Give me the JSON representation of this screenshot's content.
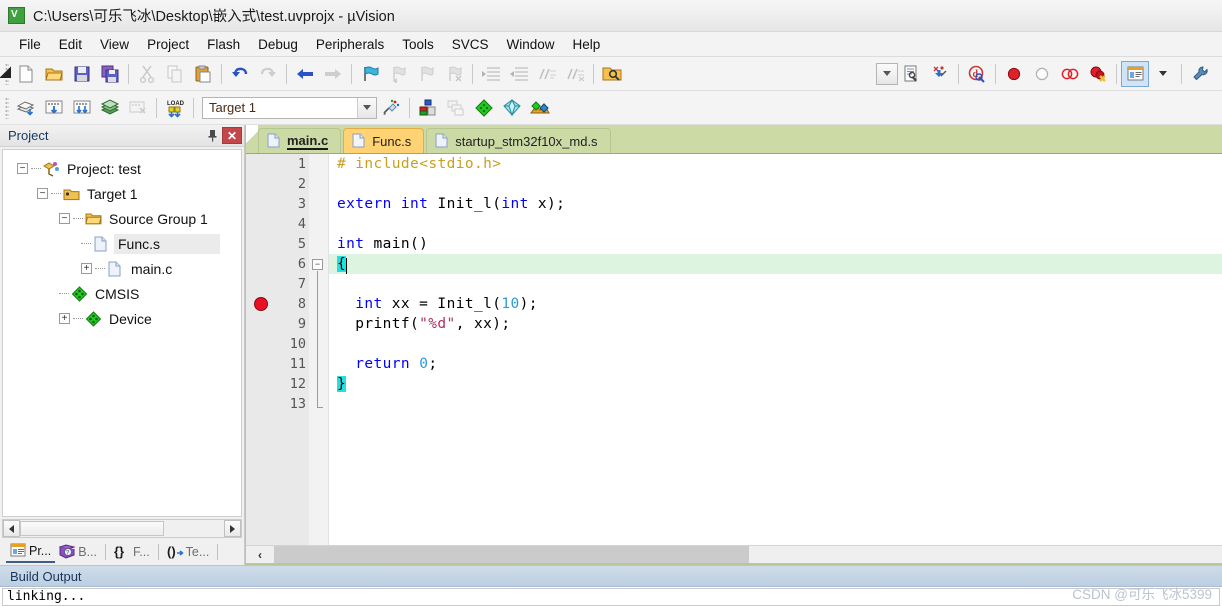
{
  "window": {
    "title": "C:\\Users\\可乐飞冰\\Desktop\\嵌入式\\test.uvprojx - µVision",
    "app_icon": "uvision-icon"
  },
  "menubar": {
    "items": [
      {
        "label": "File"
      },
      {
        "label": "Edit"
      },
      {
        "label": "View"
      },
      {
        "label": "Project"
      },
      {
        "label": "Flash"
      },
      {
        "label": "Debug"
      },
      {
        "label": "Peripherals"
      },
      {
        "label": "Tools"
      },
      {
        "label": "SVCS"
      },
      {
        "label": "Window"
      },
      {
        "label": "Help"
      }
    ]
  },
  "toolbar_row1": {
    "buttons": [
      {
        "name": "new-file-icon"
      },
      {
        "name": "open-file-icon"
      },
      {
        "name": "save-icon"
      },
      {
        "name": "save-all-icon"
      },
      {
        "name": "cut-icon"
      },
      {
        "name": "copy-icon"
      },
      {
        "name": "paste-icon"
      },
      {
        "name": "undo-icon"
      },
      {
        "name": "redo-icon"
      },
      {
        "name": "navigate-back-icon"
      },
      {
        "name": "navigate-forward-icon"
      },
      {
        "name": "bookmark-toggle-icon"
      },
      {
        "name": "bookmark-prev-icon"
      },
      {
        "name": "bookmark-next-icon"
      },
      {
        "name": "bookmark-clear-icon"
      },
      {
        "name": "indent-icon"
      },
      {
        "name": "outdent-icon"
      },
      {
        "name": "comment-icon"
      },
      {
        "name": "uncomment-icon"
      },
      {
        "name": "find-in-files-icon"
      }
    ],
    "right_buttons": [
      {
        "name": "dropdown-icon"
      },
      {
        "name": "configure-target-icon"
      },
      {
        "name": "download-icon"
      },
      {
        "name": "start-debug-icon"
      },
      {
        "name": "insert-breakpoint-icon"
      },
      {
        "name": "kill-breakpoint-icon"
      },
      {
        "name": "disable-breakpoint-icon"
      },
      {
        "name": "kill-all-breakpoints-icon"
      },
      {
        "name": "project-window-icon"
      },
      {
        "name": "project-window-dropdown-icon"
      },
      {
        "name": "configure-icon"
      }
    ]
  },
  "toolbar_row2": {
    "buttons": [
      {
        "name": "translate-icon"
      },
      {
        "name": "build-icon"
      },
      {
        "name": "rebuild-icon"
      },
      {
        "name": "batch-build-icon"
      },
      {
        "name": "stop-build-icon"
      },
      {
        "name": "load-icon"
      }
    ],
    "target_combo": {
      "value": "Target 1",
      "placeholder": "Target"
    },
    "after_combo": [
      {
        "name": "target-options-icon"
      },
      {
        "name": "manage-project-items-icon"
      },
      {
        "name": "manage-multi-project-icon"
      },
      {
        "name": "pack-installer-icon"
      },
      {
        "name": "run-time-env-icon"
      },
      {
        "name": "manage-rte-icon"
      }
    ]
  },
  "project_panel": {
    "title": "Project",
    "pin_icon": "pin-icon",
    "close_icon": "close-icon",
    "tree": [
      {
        "label": "Project: test",
        "depth": 0,
        "expander": "minus",
        "icon": "project-icon",
        "selected": false
      },
      {
        "label": "Target 1",
        "depth": 1,
        "expander": "minus",
        "icon": "target-icon",
        "selected": false
      },
      {
        "label": "Source Group 1",
        "depth": 2,
        "expander": "minus",
        "icon": "folder-icon",
        "selected": false
      },
      {
        "label": "Func.s",
        "depth": 3,
        "expander": "none",
        "icon": "file-icon",
        "selected": true
      },
      {
        "label": "main.c",
        "depth": 3,
        "expander": "plus",
        "icon": "file-icon",
        "selected": false
      },
      {
        "label": "CMSIS",
        "depth": 2,
        "expander": "none",
        "icon": "component-icon",
        "selected": false
      },
      {
        "label": "Device",
        "depth": 2,
        "expander": "plus",
        "icon": "component-icon",
        "selected": false
      }
    ],
    "scrollbar": {
      "left_arrow": "arrow-left-icon",
      "right_arrow": "arrow-right-icon"
    },
    "bottom_tabs": [
      {
        "label": "Pr...",
        "icon": "project-tab-icon",
        "active": true
      },
      {
        "label": "B...",
        "icon": "books-tab-icon",
        "active": false
      },
      {
        "label": "F...",
        "icon": "functions-tab-icon",
        "active": false
      },
      {
        "label": "Te...",
        "icon": "templates-tab-icon",
        "active": false
      }
    ]
  },
  "editor": {
    "tabs": [
      {
        "label": "main.c",
        "state": "active",
        "icon": "c-file-icon"
      },
      {
        "label": "Func.s",
        "state": "highlight",
        "icon": "asm-file-icon"
      },
      {
        "label": "startup_stm32f10x_md.s",
        "state": "normal",
        "icon": "asm-file-icon"
      }
    ],
    "lines": [
      {
        "no": "1",
        "tokens": [
          {
            "t": "# ",
            "c": "pre"
          },
          {
            "t": "include<stdio.h>",
            "c": "pre"
          }
        ]
      },
      {
        "no": "2",
        "tokens": []
      },
      {
        "no": "3",
        "tokens": [
          {
            "t": "extern",
            "c": "kw"
          },
          {
            "t": " ",
            "c": ""
          },
          {
            "t": "int",
            "c": "kw"
          },
          {
            "t": " Init_l(",
            "c": ""
          },
          {
            "t": "int",
            "c": "kw"
          },
          {
            "t": " x);",
            "c": ""
          }
        ]
      },
      {
        "no": "4",
        "tokens": []
      },
      {
        "no": "5",
        "tokens": [
          {
            "t": "int",
            "c": "kw"
          },
          {
            "t": " main()",
            "c": ""
          }
        ]
      },
      {
        "no": "6",
        "tokens": [
          {
            "t": "{",
            "c": "brace"
          }
        ]
      },
      {
        "no": "7",
        "tokens": []
      },
      {
        "no": "8",
        "tokens": [
          {
            "t": "  ",
            "c": ""
          },
          {
            "t": "int",
            "c": "kw"
          },
          {
            "t": " xx = Init_l(",
            "c": ""
          },
          {
            "t": "10",
            "c": "num"
          },
          {
            "t": ");",
            "c": ""
          }
        ]
      },
      {
        "no": "9",
        "tokens": [
          {
            "t": "  printf(",
            "c": ""
          },
          {
            "t": "\"%d\"",
            "c": "str"
          },
          {
            "t": ", xx);",
            "c": ""
          }
        ]
      },
      {
        "no": "10",
        "tokens": []
      },
      {
        "no": "11",
        "tokens": [
          {
            "t": "  ",
            "c": ""
          },
          {
            "t": "return",
            "c": "kw"
          },
          {
            "t": " ",
            "c": ""
          },
          {
            "t": "0",
            "c": "num"
          },
          {
            "t": ";",
            "c": ""
          }
        ]
      },
      {
        "no": "12",
        "tokens": [
          {
            "t": "}",
            "c": "brace"
          }
        ]
      },
      {
        "no": "13",
        "tokens": []
      }
    ],
    "breakpoint_line": 8,
    "current_line": 6,
    "fold_start_line": 6,
    "fold_end_line": 13,
    "scroll_left_icon": "scroll-left-icon"
  },
  "build_output": {
    "title": "Build Output",
    "lines": [
      "linking..."
    ]
  },
  "watermark": {
    "text": "CSDN @可乐飞冰5399"
  },
  "colors": {
    "tab_strip": "#ccdba6",
    "tab_highlight": "#ffd274",
    "breakpoint": "#e81123",
    "current_line": "#ddf5e0",
    "brace_match": "#22e0e0",
    "keyword": "#0000ff",
    "string": "#b03060",
    "number": "#2e9bd6",
    "preprocessor": "#c8a020",
    "panel_title_text": "#17365d"
  }
}
